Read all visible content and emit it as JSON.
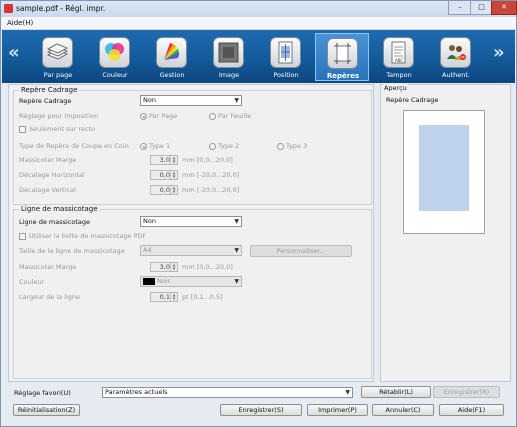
{
  "window": {
    "title": "sample.pdf - Régl. impr.",
    "minimize": "–",
    "maximize": "□",
    "close": "✕"
  },
  "menu": {
    "aide": "Aide(H)"
  },
  "toolbar": {
    "nav_left": "«",
    "nav_right": "»",
    "tabs": [
      {
        "label": "Par page",
        "icon": "paper-stack-icon"
      },
      {
        "label": "Couleur",
        "icon": "color-circles-icon"
      },
      {
        "label": "Gestion",
        "icon": "color-fan-icon"
      },
      {
        "label": "Image",
        "icon": "image-frame-icon"
      },
      {
        "label": "Position",
        "icon": "position-page-icon"
      },
      {
        "label": "Repères",
        "icon": "crop-marks-icon",
        "active": true
      },
      {
        "label": "Tampon",
        "icon": "stamp-page-icon"
      },
      {
        "label": "Authent.",
        "icon": "users-auth-icon"
      }
    ]
  },
  "repere": {
    "legend": "Repère Cadrage",
    "repere_label": "Repère Cadrage",
    "repere_value": "Non",
    "reglage_label": "Réglage pour Imposition",
    "reglage_opt1": "Par Page",
    "reglage_opt2": "Par Feuille",
    "recto_label": "Seulement sur recto",
    "type_label": "Type de Repère de Coupe en Coin",
    "type1": "Type 1",
    "type2": "Type 2",
    "type3": "Type 3",
    "marge_label": "Massicoter Marge",
    "marge_value": "3,0",
    "marge_range": "mm [0,0...20,0]",
    "dech_label": "Décalage Horizontal",
    "dech_value": "0,0",
    "dech_range": "mm [-20,0...20,0]",
    "decv_label": "Décalage Vertical",
    "decv_value": "0,0",
    "decv_range": "mm [-20,0...20,0]"
  },
  "ligne": {
    "legend": "Ligne de massicotage",
    "ligne_label": "Ligne de massicotage",
    "ligne_value": "Non",
    "boite_label": "Utiliser la boîte de massicotage PDF",
    "taille_label": "Taille de la ligne de massicotage",
    "taille_value": "A4",
    "personnaliser": "Personnaliser...",
    "marge_label": "Massicoter Marge",
    "marge_value": "3,0",
    "marge_range": "mm [0,0...20,0]",
    "couleur_label": "Couleur",
    "couleur_value": "Noir",
    "couleur_swatch": "#000000",
    "largeur_label": "Largeur de la ligne",
    "largeur_value": "0,1",
    "largeur_range": "pt [0,1...0,5]"
  },
  "preview": {
    "legend": "Aperçu",
    "title": "Repère Cadrage",
    "paper_color": "#ffffff",
    "image_color": "#bed2ec"
  },
  "bottom": {
    "favori_label": "Réglage favori(U)",
    "favori_value": "Paramètres actuels",
    "retablir": "Rétablir(L)",
    "enregistrer_fav": "Enregistrer(R)",
    "reinitialisation": "Réinitialisation(Z)",
    "enregistrer": "Enregistrer(S)",
    "imprimer": "Imprimer(P)",
    "annuler": "Annuler(C)",
    "aide": "Aide(F1)"
  },
  "colors": {
    "toolbar": "#135a9a",
    "active_tab": "#3a83c8",
    "close": "#c8453a"
  }
}
